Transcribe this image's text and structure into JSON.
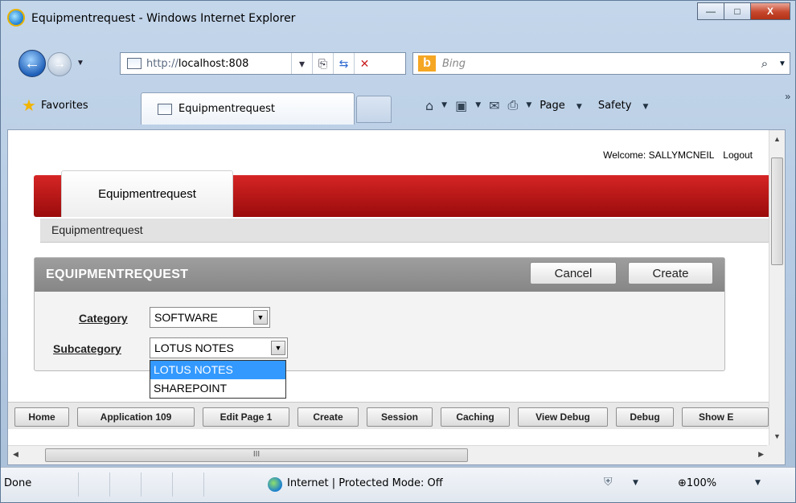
{
  "window": {
    "title": "Equipmentrequest - Windows Internet Explorer",
    "controls": {
      "minimize": "—",
      "maximize": "□",
      "close": "X"
    }
  },
  "address": {
    "url_prefix": "http://",
    "url_host": "localhost:808",
    "search_placeholder": "Bing"
  },
  "commandbar": {
    "favorites_label": "Favorites",
    "active_tab_label": "Equipmentrequest",
    "page_label": "Page",
    "safety_label": "Safety"
  },
  "app": {
    "welcome_label": "Welcome: SALLYMCNEIL",
    "logout_label": "Logout",
    "tab_label": "Equipmentrequest",
    "breadcrumb": "Equipmentrequest",
    "region_title": "EQUIPMENTREQUEST",
    "cancel_label": "Cancel",
    "create_label": "Create",
    "category_label": "Category",
    "category_value": "SOFTWARE",
    "subcategory_label": "Subcategory",
    "subcategory_value": "LOTUS NOTES",
    "subcategory_options": [
      "LOTUS NOTES",
      "SHAREPOINT"
    ]
  },
  "devbar": {
    "buttons": [
      "Home",
      "Application 109",
      "Edit Page 1",
      "Create",
      "Session",
      "Caching",
      "View Debug",
      "Debug",
      "Show E"
    ]
  },
  "hscroll_grip": "III",
  "status": {
    "done": "Done",
    "zone": "Internet | Protected Mode: Off",
    "zoom": "100%"
  },
  "colors": {
    "app_header_red": "#b31515",
    "region_header_gray": "#929292",
    "selection_blue": "#3399ff"
  }
}
